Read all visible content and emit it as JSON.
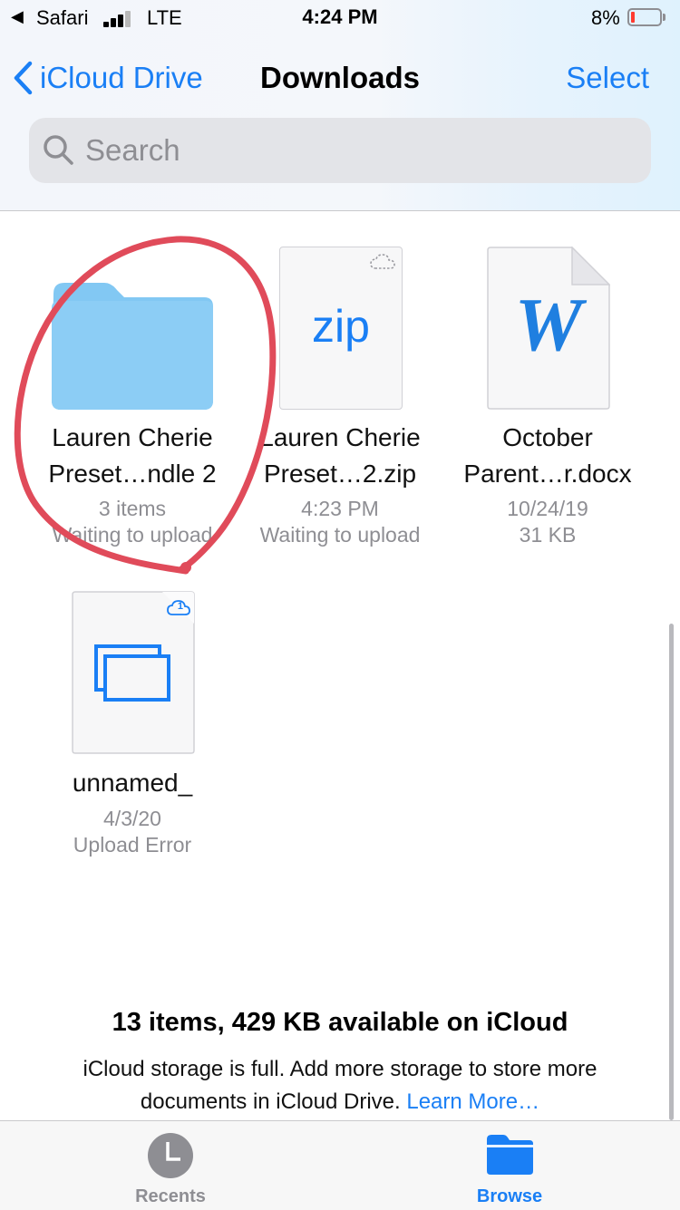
{
  "status_bar": {
    "back_app": "Safari",
    "network": "LTE",
    "time": "4:24 PM",
    "battery_percent": "8%",
    "battery_level": 0.08
  },
  "nav": {
    "back_label": "iCloud Drive",
    "title": "Downloads",
    "select_label": "Select"
  },
  "search": {
    "placeholder": "Search"
  },
  "files": [
    {
      "name_line1": "Lauren Cherie",
      "name_line2": "Preset…ndle 2",
      "meta1": "3 items",
      "meta2": "Waiting to upload",
      "type": "folder"
    },
    {
      "name_line1": "Lauren Cherie",
      "name_line2": "Preset…2.zip",
      "meta1": "4:23 PM",
      "meta2": "Waiting to upload",
      "type": "zip",
      "badge": "zip"
    },
    {
      "name_line1": "October",
      "name_line2": "Parent…r.docx",
      "meta1": "10/24/19",
      "meta2": "31 KB",
      "type": "word",
      "badge": "W"
    },
    {
      "name_line1": "unnamed_",
      "meta1": "4/3/20",
      "meta2": "Upload Error",
      "type": "generic",
      "cloud_badge": "1"
    }
  ],
  "footer": {
    "summary": "13 items, 429 KB available on iCloud",
    "message": "iCloud storage is full. Add more storage to store more documents in iCloud Drive.",
    "learn_more": "Learn More…"
  },
  "tabs": [
    {
      "label": "Recents",
      "selected": false
    },
    {
      "label": "Browse",
      "selected": true
    }
  ],
  "colors": {
    "accent": "#1a7ff5",
    "folder": "#82c8f3",
    "annotation": "#e04b5a",
    "battery_low": "#ff3b30"
  }
}
